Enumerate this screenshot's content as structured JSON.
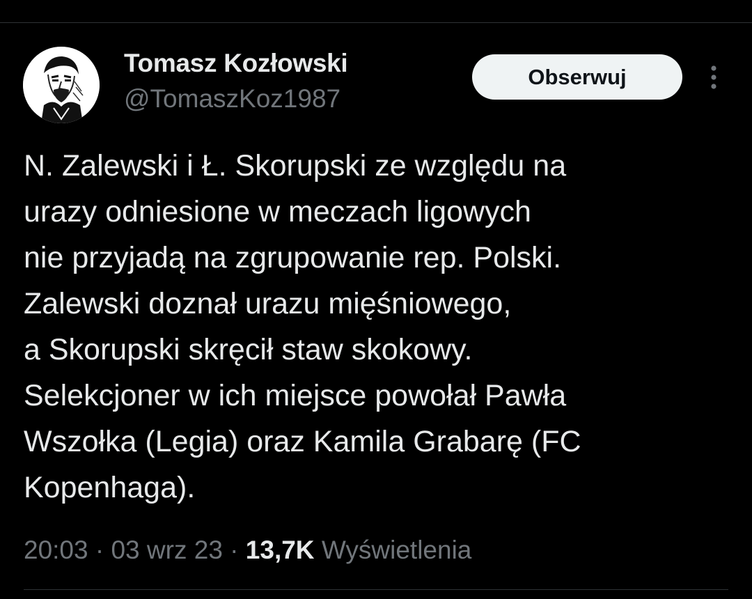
{
  "author": {
    "name": "Tomasz Kozłowski",
    "handle": "@TomaszKoz1987",
    "avatar_icon": "portrait-sketch-avatar"
  },
  "follow_button": {
    "label": "Obserwuj"
  },
  "more_button": {
    "icon": "more-vertical-icon"
  },
  "tweet": {
    "lines": [
      "N. Zalewski i Ł. Skorupski ze względu na",
      "urazy odniesione w meczach ligowych",
      "nie przyjadą na zgrupowanie rep. Polski.",
      "Zalewski doznał urazu mięśniowego,",
      "a Skorupski skręcił staw skokowy.",
      "Selekcjoner w ich miejsce powołał Pawła",
      "Wszołka (Legia) oraz Kamila Grabarę (FC",
      "Kopenhaga)."
    ]
  },
  "meta": {
    "time": "20:03",
    "separator": " · ",
    "date": "03 wrz 23",
    "views_count": "13,7K",
    "views_label": "Wyświetlenia"
  },
  "colors": {
    "background": "#000000",
    "primary_text": "#e7e9ea",
    "secondary_text": "#71767b",
    "button_bg": "#eff3f4",
    "divider": "#2f3336"
  }
}
